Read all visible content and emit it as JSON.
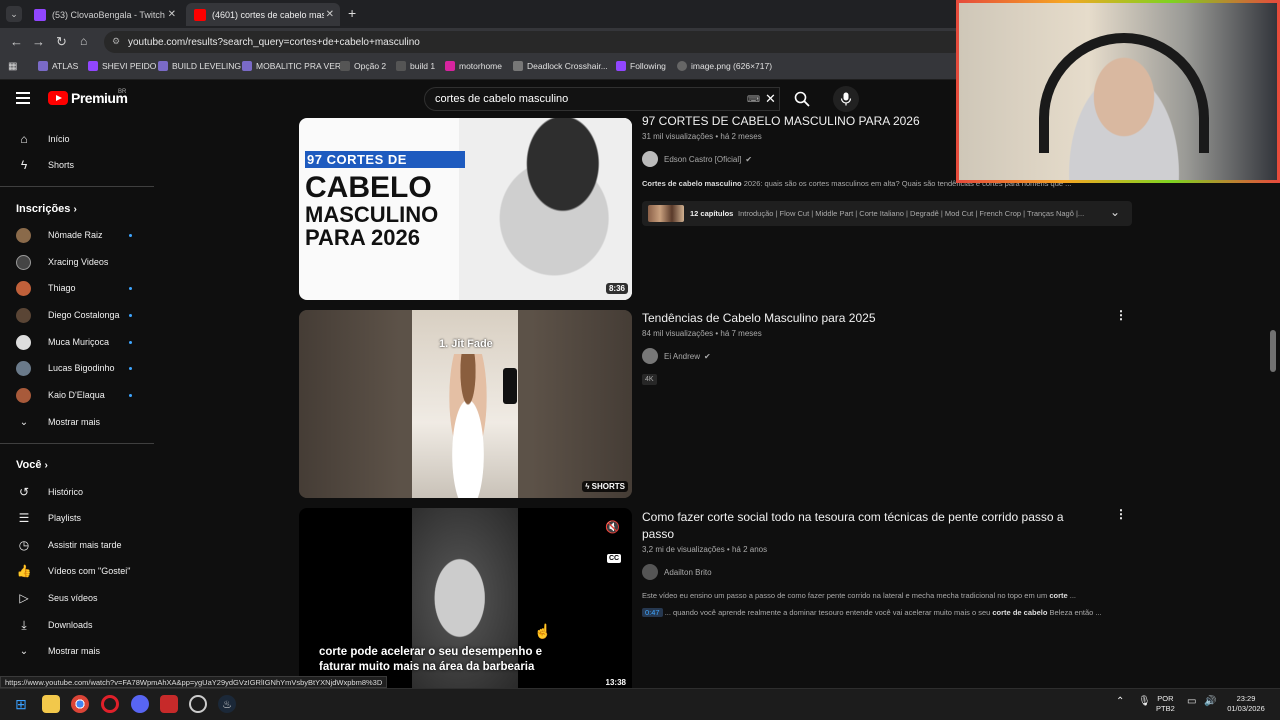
{
  "browser": {
    "tabs": [
      {
        "label": "(53) ClovaoBengala - Twitch",
        "color": "#9146ff"
      },
      {
        "label": "(4601) cortes de cabelo masculi",
        "color": "#ff0000"
      }
    ],
    "new_tab": "+",
    "url": "youtube.com/results?search_query=cortes+de+cabelo+masculino",
    "bookmarks": [
      "ATLAS",
      "SHEVI PEIDO",
      "BUILD LEVELING",
      "MOBALITIC PRA VER",
      "Opção 2",
      "build 1",
      "motorhome",
      "Deadlock Crosshair...",
      "Following",
      "image.png (626×717)"
    ]
  },
  "youtube": {
    "logo_text": "Premium",
    "country": "BR",
    "search": {
      "value": "cortes de cabelo masculino"
    },
    "sidebar": {
      "main": [
        {
          "label": "Início",
          "icon": "home-icon"
        },
        {
          "label": "Shorts",
          "icon": "shorts-icon"
        }
      ],
      "subscriptions_title": "Inscrições",
      "subscriptions": [
        {
          "label": "Nômade Raiz",
          "color": "#8a6a4a",
          "dot": true
        },
        {
          "label": "Xracing Videos",
          "color": "#444",
          "dot": false
        },
        {
          "label": "Thiago",
          "color": "#c0603a",
          "dot": true
        },
        {
          "label": "Diego Costalonga",
          "color": "#5a4535",
          "dot": true
        },
        {
          "label": "Muca Muriçoca",
          "color": "#ddd",
          "dot": true
        },
        {
          "label": "Lucas Bigodinho",
          "color": "#6a7a8a",
          "dot": true
        },
        {
          "label": "Kaio D'Elaqua",
          "color": "#a85a3a",
          "dot": true
        }
      ],
      "show_more": "Mostrar mais",
      "you_title": "Você",
      "you_items": [
        {
          "label": "Histórico",
          "icon": "history-icon"
        },
        {
          "label": "Playlists",
          "icon": "playlists-icon"
        },
        {
          "label": "Assistir mais tarde",
          "icon": "watch-later-icon"
        },
        {
          "label": "Vídeos com \"Gostei\"",
          "icon": "thumbs-up-icon"
        },
        {
          "label": "Seus vídeos",
          "icon": "your-videos-icon"
        },
        {
          "label": "Downloads",
          "icon": "download-icon"
        }
      ],
      "show_more_2": "Mostrar mais"
    },
    "results": [
      {
        "title": "97 CORTES DE CABELO MASCULINO PARA 2026",
        "meta": "31 mil visualizações • há 2 meses",
        "channel": "Edson Castro [Oficial]",
        "desc_bold": "Cortes de cabelo masculino",
        "desc": " 2026: quais são os cortes masculinos em alta? Quais são tendências e cortes para homens que ...",
        "chapters_count": "12 capítulos",
        "chapters": "Introdução | Flow Cut | Middle Part | Corte Italiano | Degradê | Mod Cut | French Crop | Tranças Nagô |...",
        "duration": "8:36",
        "thumb_lines": [
          "97 CORTES DE",
          "CABELO",
          "MASCULINO",
          "PARA 2026"
        ]
      },
      {
        "title": "Tendências de Cabelo Masculino para 2025",
        "meta": "84 mil visualizações • há 7 meses",
        "channel": "Ei Andrew",
        "badge": "4K",
        "thumb_caption": "1. Jit Fade",
        "shorts_label": "SHORTS"
      },
      {
        "title": "Como fazer corte social todo na tesoura com técnicas de pente corrido passo a passo",
        "meta": "3,2 mi de visualizações • há 2 anos",
        "channel": "Adailton Brito",
        "desc_pre": "Este vídeo eu ensino um passo a passo de como fazer pente corrido na lateral e mecha mecha tradicional no topo em um ",
        "desc_bold": "corte",
        "desc_post": " ...",
        "timestamp": "0:47",
        "desc2_pre": " ... quando você aprende realmente a dominar tesouro entende você vai acelerar muito mais o seu ",
        "desc2_bold": "corte de cabelo",
        "desc2_post": " Beleza então ...",
        "subtitle_lines": [
          "corte pode acelerar o seu desempenho e",
          "faturar muito mais na área da barbearia"
        ],
        "duration": "13:38",
        "cc_label": "CC"
      }
    ]
  },
  "status_url": "https://www.youtube.com/watch?v=FA78WpmAhXA&pp=ygUaY29ydGVzIGRlIGNhYmVsbyBtYXNjdWxpbm8%3D",
  "taskbar": {
    "lang": [
      "POR",
      "PTB2"
    ],
    "time": "23:29",
    "date": "01/03/2026"
  }
}
